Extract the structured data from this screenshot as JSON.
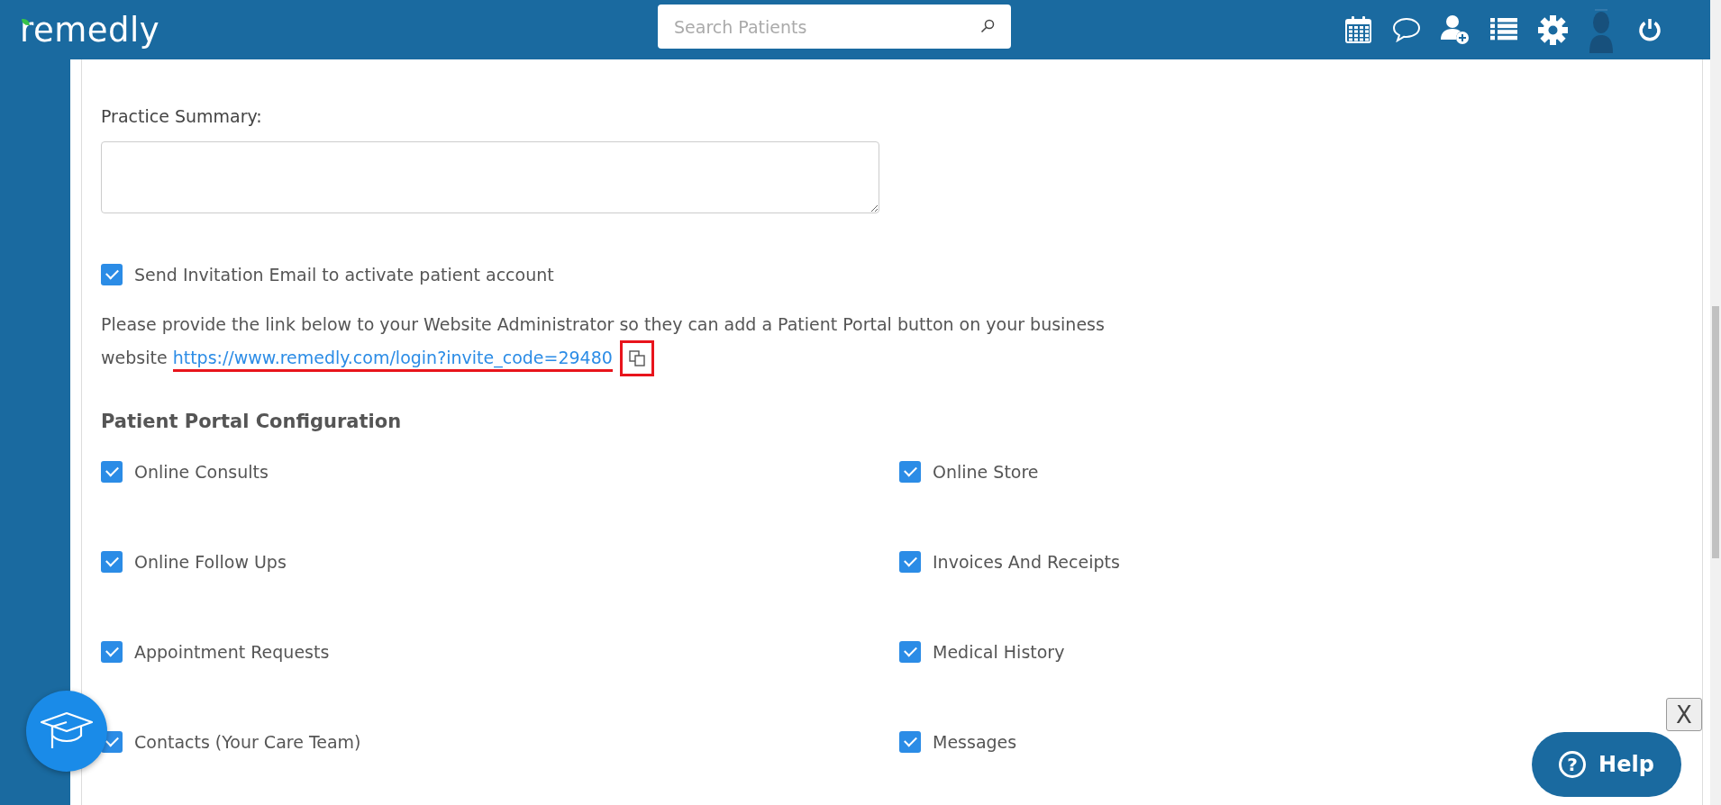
{
  "header": {
    "logo": "remedly",
    "search": {
      "placeholder": "Search Patients"
    }
  },
  "practice_summary": {
    "label": "Practice Summary:"
  },
  "invitation": {
    "label": "Send Invitation Email to activate patient account",
    "checked": true
  },
  "portal_link": {
    "text": "Please provide the link below to your Website Administrator so they can add a Patient Portal button on your business website",
    "link": "https://www.remedly.com/login?invite_code=29480"
  },
  "portal_configuration": {
    "title": "Patient Portal Configuration",
    "options": [
      {
        "label": "Online Consults",
        "checked": true
      },
      {
        "label": "Online Store",
        "checked": true
      },
      {
        "label": "Online Follow Ups",
        "checked": true
      },
      {
        "label": "Invoices And Receipts",
        "checked": true
      },
      {
        "label": "Appointment Requests",
        "checked": true
      },
      {
        "label": "Medical History",
        "checked": true
      },
      {
        "label": "Contacts (Your Care Team)",
        "checked": true
      },
      {
        "label": "Messages",
        "checked": true
      }
    ]
  },
  "close_label": "X",
  "help_button": {
    "label": "Help",
    "icon": "?"
  }
}
